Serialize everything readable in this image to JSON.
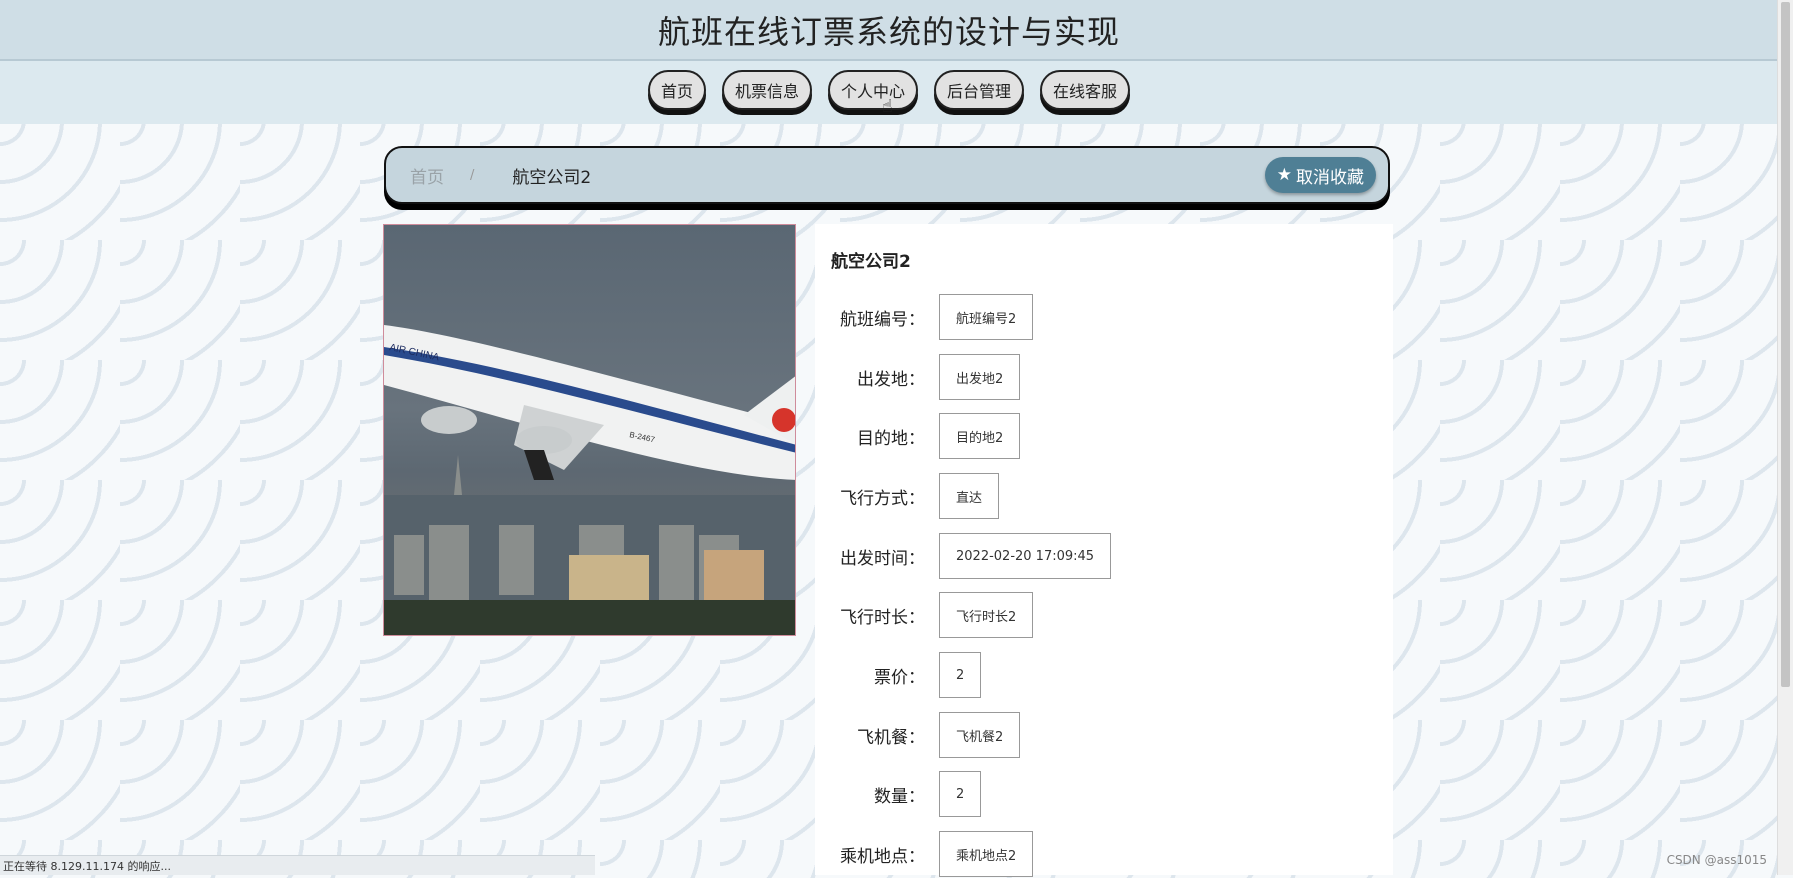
{
  "header": {
    "title": "航班在线订票系统的设计与实现"
  },
  "nav": [
    {
      "label": "首页"
    },
    {
      "label": "机票信息"
    },
    {
      "label": "个人中心"
    },
    {
      "label": "后台管理"
    },
    {
      "label": "在线客服"
    }
  ],
  "breadcrumb": {
    "home": "首页",
    "separator": "/",
    "current": "航空公司2",
    "favorite_label": "取消收藏",
    "favorite_icon": "star-icon"
  },
  "detail": {
    "name": "航空公司2",
    "fields": [
      {
        "label": "航班编号：",
        "value": "航班编号2"
      },
      {
        "label": "出发地：",
        "value": "出发地2"
      },
      {
        "label": "目的地：",
        "value": "目的地2"
      },
      {
        "label": "飞行方式：",
        "value": "直达"
      },
      {
        "label": "出发时间：",
        "value": "2022-02-20 17:09:45"
      },
      {
        "label": "飞行时长：",
        "value": "飞行时长2"
      },
      {
        "label": "票价：",
        "value": "2"
      },
      {
        "label": "飞机餐：",
        "value": "飞机餐2"
      },
      {
        "label": "数量：",
        "value": "2"
      },
      {
        "label": "乘机地点：",
        "value": "乘机地点2"
      }
    ]
  },
  "photo": {
    "livery_text": "AIR CHINA",
    "registration": "B-2467"
  },
  "status_bar": {
    "text": "正在等待 8.129.11.174 的响应..."
  },
  "watermark": {
    "text": "CSDN @ass1015"
  },
  "colors": {
    "accent": "#4f7f95",
    "header_bg": "#cfdee6",
    "nav_bg": "#dce9ef"
  }
}
